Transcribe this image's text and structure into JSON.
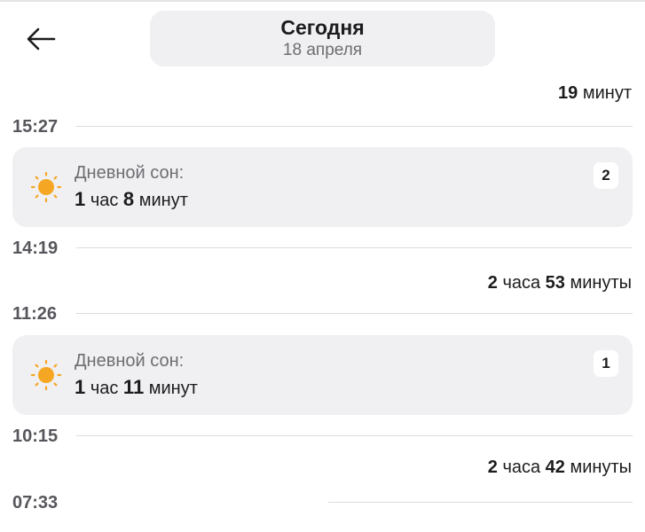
{
  "header": {
    "title": "Сегодня",
    "date": "18 апреля"
  },
  "timeline": {
    "duration_top": {
      "num": "19",
      "unit": "минут"
    },
    "time_1": "15:27",
    "card_1": {
      "label": "Дневной сон:",
      "hours_num": "1",
      "hours_unit": "час",
      "minutes_num": "8",
      "minutes_unit": "минут",
      "badge": "2"
    },
    "time_2": "14:19",
    "duration_2": {
      "hours_num": "2",
      "hours_unit": "часа",
      "minutes_num": "53",
      "minutes_unit": "минуты"
    },
    "time_3": "11:26",
    "card_2": {
      "label": "Дневной сон:",
      "hours_num": "1",
      "hours_unit": "час",
      "minutes_num": "11",
      "minutes_unit": "минут",
      "badge": "1"
    },
    "time_4": "10:15",
    "duration_3": {
      "hours_num": "2",
      "hours_unit": "часа",
      "minutes_num": "42",
      "minutes_unit": "минуты"
    },
    "time_5": "07:33"
  },
  "icons": {
    "back": "arrow-left-icon",
    "sleep": "sun-icon"
  },
  "colors": {
    "sun": "#f5a623",
    "card_bg": "#f0f0f2",
    "time_text": "#56565c",
    "divider": "#dcdce0"
  }
}
